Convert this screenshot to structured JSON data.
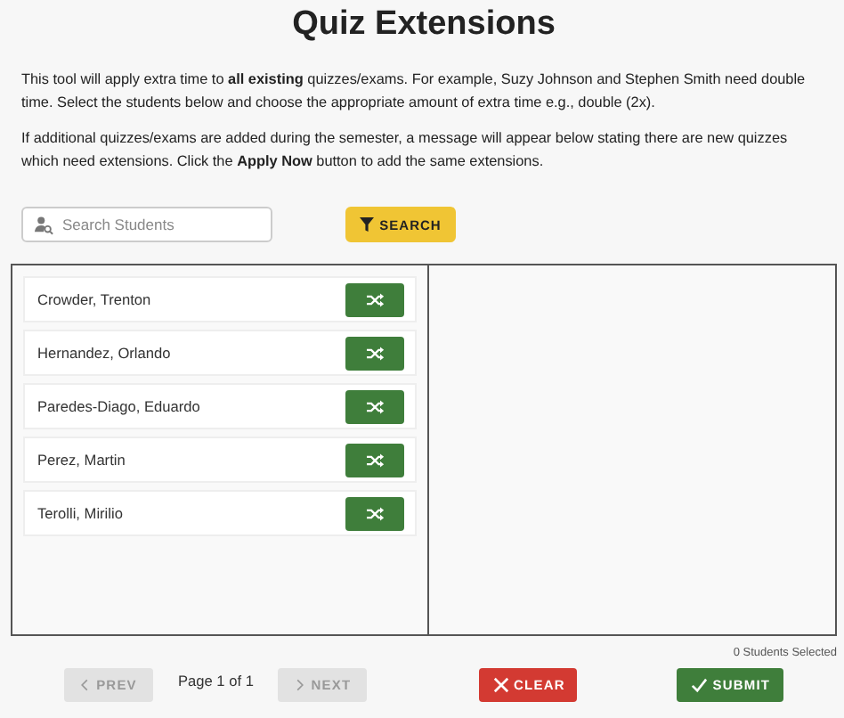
{
  "title": "Quiz Extensions",
  "paragraphs": [
    "This tool will apply extra time to **all existing** quizzes/exams. For example, Suzy Johnson and Stephen Smith need double time. Select the students below and choose the appropriate amount of extra time e.g., double (2x).",
    "If additional quizzes/exams are added during the semester, a message will appear below stating there are new quizzes which need extensions. Click the **Apply Now** button to add the same extensions."
  ],
  "search": {
    "placeholder": "Search Students",
    "button": "SEARCH"
  },
  "students": [
    {
      "name": "Crowder, Trenton"
    },
    {
      "name": "Hernandez, Orlando"
    },
    {
      "name": "Paredes-Diago, Eduardo"
    },
    {
      "name": "Perez, Martin"
    },
    {
      "name": "Terolli, Mirilio"
    }
  ],
  "selected_count": "0 Students Selected",
  "pagination": {
    "prev": {
      "label": "PREV",
      "disabled": true
    },
    "page": "Page 1 of 1",
    "next": {
      "label": "NEXT",
      "disabled": true
    }
  },
  "actions": [
    {
      "kind": "clear",
      "label": "CLEAR"
    },
    {
      "kind": "submit",
      "label": "SUBMIT"
    }
  ]
}
